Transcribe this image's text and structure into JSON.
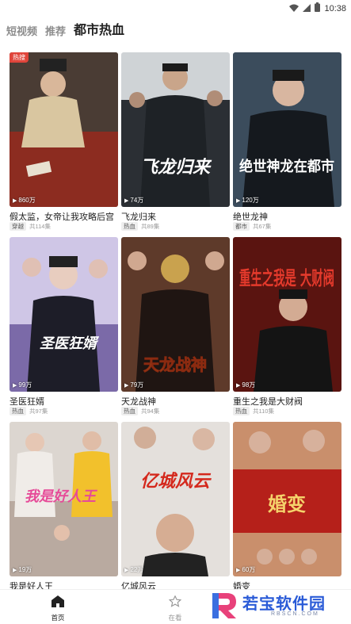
{
  "status": {
    "time": "10:38"
  },
  "tabs": [
    {
      "label": "短视频"
    },
    {
      "label": "推荐"
    },
    {
      "label": "都市热血",
      "active": true
    }
  ],
  "cards": [
    {
      "title": "假太监，女帝让我攻略后宫",
      "genre": "穿越",
      "episodes": "共114集",
      "views": "860万",
      "badge": "热搜",
      "poster_text": ""
    },
    {
      "title": "飞龙归来",
      "genre": "热血",
      "episodes": "共89集",
      "views": "74万",
      "badge": "",
      "poster_text": "飞龙归来"
    },
    {
      "title": "绝世龙神",
      "genre": "都市",
      "episodes": "共67集",
      "views": "120万",
      "badge": "",
      "poster_text": "绝世神龙在都市"
    },
    {
      "title": "圣医狂婿",
      "genre": "热血",
      "episodes": "共97集",
      "views": "99万",
      "badge": "",
      "poster_text": "圣医狂婿"
    },
    {
      "title": "天龙战神",
      "genre": "热血",
      "episodes": "共94集",
      "views": "79万",
      "badge": "",
      "poster_text": "天龙战神"
    },
    {
      "title": "重生之我是大财阀",
      "genre": "热血",
      "episodes": "共110集",
      "views": "98万",
      "badge": "",
      "poster_text": "重生之我是 大财阀"
    },
    {
      "title": "我是好人王",
      "genre": "",
      "episodes": "",
      "views": "19万",
      "badge": "",
      "poster_text": "我是好人王"
    },
    {
      "title": "亿城风云",
      "genre": "",
      "episodes": "",
      "views": "22万",
      "badge": "",
      "poster_text": "亿城风云"
    },
    {
      "title": "婚变",
      "genre": "",
      "episodes": "",
      "views": "60万",
      "badge": "",
      "poster_text": "婚变"
    }
  ],
  "bottom_nav": [
    {
      "label": "首页",
      "icon": "home-icon",
      "active": true
    },
    {
      "label": "在看",
      "icon": "star-icon",
      "active": false
    }
  ],
  "watermark": {
    "name": "若宝软件园",
    "url": "RBSCN.COM"
  },
  "colors": {
    "hot_badge": "#e0453b",
    "accent_blue": "#2a5bd7",
    "active_text": "#222222",
    "inactive_text": "#8d8d8d"
  }
}
